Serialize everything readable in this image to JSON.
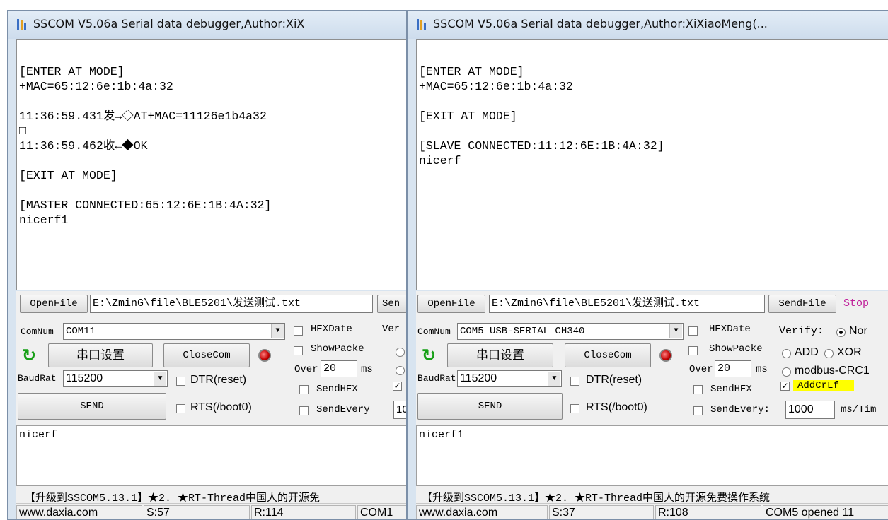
{
  "left": {
    "title": "SSCOM V5.06a Serial data debugger,Author:XiX",
    "terminal": [
      "[ENTER AT MODE]",
      "+MAC=65:12:6e:1b:4a:32",
      "",
      "11:36:59.431发→◇AT+MAC=11126e1b4a32",
      "□",
      "11:36:59.462收←◆OK",
      "",
      "[EXIT AT MODE]",
      "",
      "[MASTER CONNECTED:65:12:6E:1B:4A:32]",
      "nicerf1"
    ],
    "openfile_label": "OpenFile",
    "file_path": "E:\\ZminG\\file\\BLE5201\\发送测试.txt",
    "sendfile_label": "Sen",
    "comnum_label": "ComNum",
    "comnum_value": "COM11",
    "hexdate_label": "HEXDate",
    "showpacket_label": "ShowPacke",
    "over_label": "Over",
    "over_value": "20",
    "ms_label": "ms",
    "verify_label": "Ver",
    "port_settings_label": "串口设置",
    "closecom_label": "CloseCom",
    "baudrate_label": "BaudRat",
    "baudrate_value": "115200",
    "dtr_label": "DTR(reset)",
    "sendhex_label": "SendHEX",
    "rts_label": "RTS(/boot0)",
    "sendevery_label": "SendEvery",
    "sendevery_value": "10",
    "send_label": "SEND",
    "send_text": "nicerf",
    "marquee": "【升级到SSCOM5.13.1】★2. ★RT-Thread中国人的开源免",
    "status_web": "www.daxia.com",
    "status_s": "S:57",
    "status_r": "R:114",
    "status_com": "COM1"
  },
  "right": {
    "title": "SSCOM V5.06a Serial data debugger,Author:XiXiaoMeng(...",
    "terminal": [
      "[ENTER AT MODE]",
      "+MAC=65:12:6e:1b:4a:32",
      "",
      "[EXIT AT MODE]",
      "",
      "[SLAVE CONNECTED:11:12:6E:1B:4A:32]",
      "nicerf"
    ],
    "openfile_label": "OpenFile",
    "file_path": "E:\\ZminG\\file\\BLE5201\\发送测试.txt",
    "sendfile_label": "SendFile",
    "stop_label": "Stop",
    "comnum_label": "ComNum",
    "comnum_value": "COM5 USB-SERIAL CH340",
    "hexdate_label": "HEXDate",
    "showpacket_label": "ShowPacke",
    "over_label": "Over",
    "over_value": "20",
    "ms_label": "ms",
    "verify_label": "Verify:",
    "verify_none": "Nor",
    "verify_add": "ADD",
    "verify_xor": "XOR",
    "verify_modbus": "modbus-CRC1",
    "port_settings_label": "串口设置",
    "closecom_label": "CloseCom",
    "baudrate_label": "BaudRat",
    "baudrate_value": "115200",
    "dtr_label": "DTR(reset)",
    "sendhex_label": "SendHEX",
    "addcrlf_label": "AddCrLf",
    "rts_label": "RTS(/boot0)",
    "sendevery_label": "SendEvery:",
    "sendevery_value": "1000",
    "sendevery_unit": "ms/Tim",
    "send_label": "SEND",
    "send_text": "nicerf1",
    "marquee": "【升级到SSCOM5.13.1】★2. ★RT-Thread中国人的开源免费操作系统",
    "status_web": "www.daxia.com",
    "status_s": "S:37",
    "status_r": "R:108",
    "status_com": "COM5 opened 11"
  },
  "colors": {
    "accent_led": "#c00000",
    "addcrlf_highlight": "#ffff00",
    "refresh_icon": "#18a018"
  }
}
